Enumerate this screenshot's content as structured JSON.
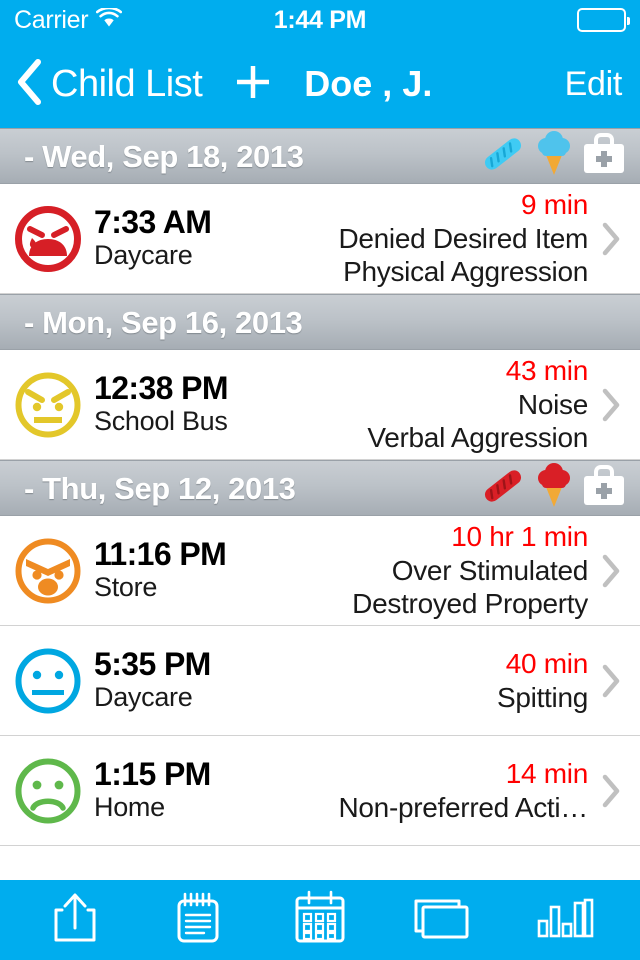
{
  "status_bar": {
    "carrier": "Carrier",
    "wifi_icon": "wifi-icon",
    "time": "1:44 PM",
    "battery_icon": "battery-icon"
  },
  "nav_bar": {
    "back_icon": "chevron-left-icon",
    "back_label": "Child List",
    "add_icon": "plus-icon",
    "title": "Doe , J.",
    "edit_label": "Edit"
  },
  "colors": {
    "brand_blue": "#00ADEE",
    "duration_red": "#FF0000",
    "section_gray_top": "#C9CED3",
    "section_gray_bottom": "#A6ADB4",
    "face_red": "#D61F26",
    "face_yellow": "#E3C72A",
    "face_orange": "#EF8B22",
    "face_blue": "#00A7E1",
    "face_green": "#5FB84B",
    "icon_cyan": "#3FCBF4",
    "icon_red": "#D91F26",
    "cone_orange": "#F2A935"
  },
  "sections": [
    {
      "date": "-  Wed, Sep 18, 2013",
      "icons": [
        {
          "name": "bread-icon",
          "color": "cyan"
        },
        {
          "name": "ice-cream-icon",
          "color": "cyan"
        },
        {
          "name": "medical-bag-icon",
          "color": "white"
        }
      ],
      "rows": [
        {
          "face": "crying-face",
          "face_color": "#D61F26",
          "time": "7:33 AM",
          "location": "Daycare",
          "duration": "9 min",
          "antecedent": "Denied Desired Item",
          "behavior": "Physical Aggression"
        }
      ]
    },
    {
      "date": "-  Mon, Sep 16, 2013",
      "icons": [],
      "rows": [
        {
          "face": "angry-face",
          "face_color": "#E3C72A",
          "time": "12:38 PM",
          "location": "School Bus",
          "duration": "43 min",
          "antecedent": "Noise",
          "behavior": "Verbal Aggression"
        }
      ]
    },
    {
      "date": "-  Thu, Sep 12, 2013",
      "icons": [
        {
          "name": "bread-icon",
          "color": "red"
        },
        {
          "name": "ice-cream-icon",
          "color": "red"
        },
        {
          "name": "medical-bag-icon",
          "color": "white"
        }
      ],
      "rows": [
        {
          "face": "shouting-face",
          "face_color": "#EF8B22",
          "time": "11:16 PM",
          "location": "Store",
          "duration": "10 hr 1 min",
          "antecedent": "Over Stimulated",
          "behavior": "Destroyed Property"
        },
        {
          "face": "neutral-face",
          "face_color": "#00A7E1",
          "time": "5:35 PM",
          "location": "Daycare",
          "duration": "40 min",
          "antecedent": "Spitting",
          "behavior": ""
        },
        {
          "face": "sad-face",
          "face_color": "#5FB84B",
          "time": "1:15 PM",
          "location": "Home",
          "duration": "14 min",
          "antecedent": "Non-preferred Acti…",
          "behavior": ""
        }
      ]
    }
  ],
  "toolbar": [
    {
      "name": "share-icon",
      "label": "Share"
    },
    {
      "name": "notepad-icon",
      "label": "Notes"
    },
    {
      "name": "calendar-icon",
      "label": "Calendar"
    },
    {
      "name": "cards-icon",
      "label": "Cards"
    },
    {
      "name": "bar-chart-icon",
      "label": "Reports"
    }
  ]
}
